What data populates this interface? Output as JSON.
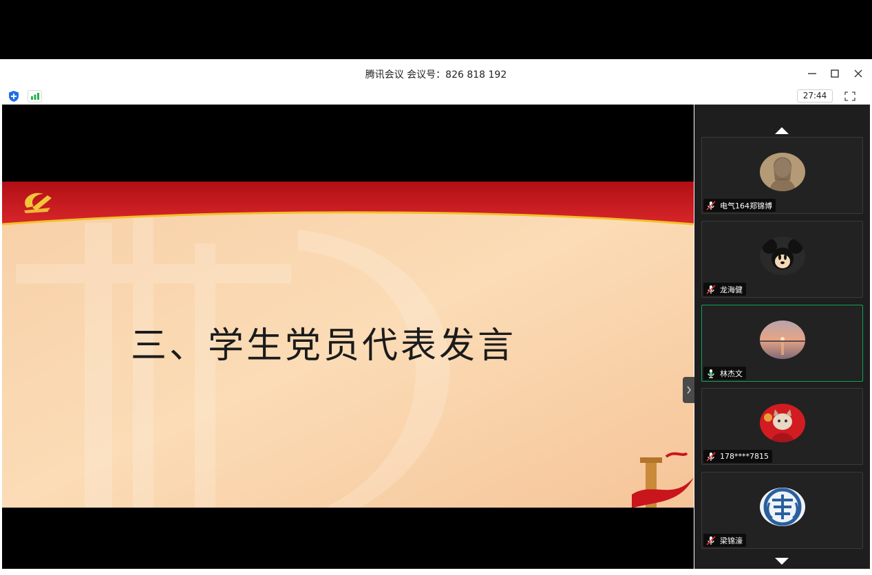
{
  "window": {
    "title": "腾讯会议 会议号：826 818 192",
    "minimize_icon": "minimize-icon",
    "maximize_icon": "maximize-icon",
    "close_icon": "close-icon"
  },
  "toolbar": {
    "security_icon": "shield-icon",
    "signal_icon": "signal-bars-icon",
    "timer": "27:44",
    "fullscreen_icon": "fullscreen-icon"
  },
  "slide": {
    "title": "三、学生党员代表发言",
    "colors": {
      "banner": "#c8151b",
      "background": "#f9d6ad",
      "gold": "#f2c02a"
    }
  },
  "participants": [
    {
      "name": "电气164郑锦博",
      "mic": "muted",
      "avatar": "portrait-photo"
    },
    {
      "name": "龙海健",
      "mic": "muted",
      "avatar": "mickey-mouse"
    },
    {
      "name": "林杰文",
      "mic": "active",
      "avatar": "sunset-sea"
    },
    {
      "name": "178****7815",
      "mic": "muted",
      "avatar": "cat-in-red"
    },
    {
      "name": "梁锦濠",
      "mic": "muted",
      "avatar": "blue-seal-character"
    }
  ],
  "colors": {
    "active_speaker_border": "#14a05a",
    "panel_bg": "#1e1e1e"
  }
}
